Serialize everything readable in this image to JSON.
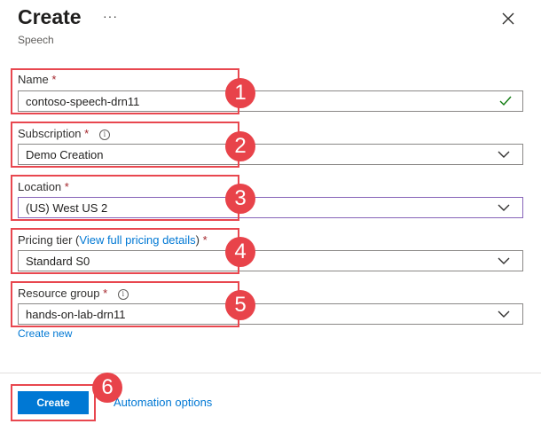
{
  "header": {
    "title": "Create",
    "more_label": "···",
    "subtitle": "Speech"
  },
  "form": {
    "name": {
      "label": "Name",
      "required_mark": "*",
      "value": "contoso-speech-drn11",
      "status_icon": "check-icon"
    },
    "subscription": {
      "label": "Subscription",
      "required_mark": "*",
      "value": "Demo Creation",
      "info_icon": "info-icon"
    },
    "location": {
      "label": "Location",
      "required_mark": "*",
      "value": "(US) West US 2"
    },
    "pricing_tier": {
      "label": "Pricing tier",
      "paren_open": "(",
      "link": "View full pricing details",
      "paren_close": ")",
      "required_mark": "*",
      "value": "Standard S0"
    },
    "resource_group": {
      "label": "Resource group",
      "required_mark": "*",
      "value": "hands-on-lab-drn11",
      "info_icon": "info-icon",
      "create_new": "Create new"
    }
  },
  "footer": {
    "create_label": "Create",
    "automation_label": "Automation options"
  },
  "annotations": [
    "1",
    "2",
    "3",
    "4",
    "5",
    "6"
  ],
  "colors": {
    "accent": "#0078d4",
    "annotation_red": "#e8434a",
    "required": "#a4262c",
    "valid": "#107c10"
  }
}
